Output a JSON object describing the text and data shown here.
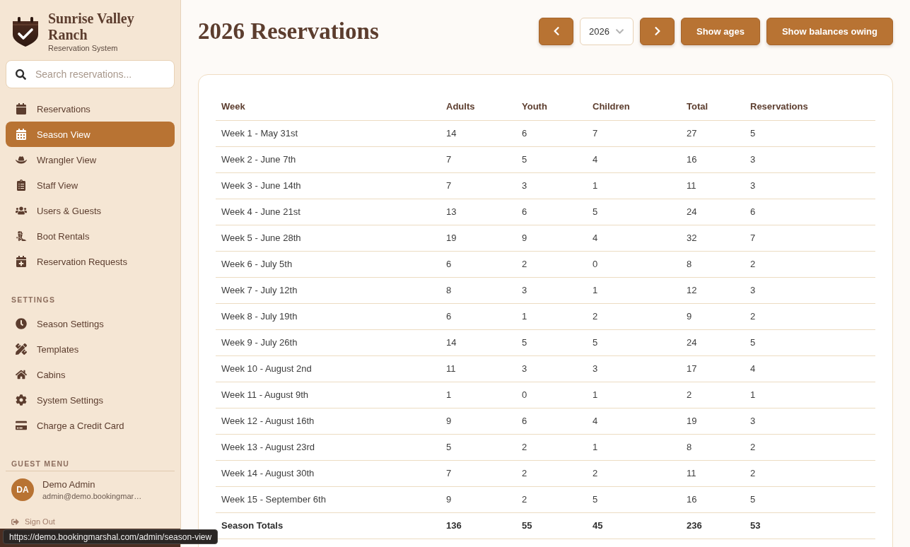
{
  "sidebar": {
    "brand": {
      "title": "Sunrise Valley Ranch",
      "subtitle": "Reservation System"
    },
    "search": {
      "placeholder": "Search reservations..."
    },
    "nav_items": [
      {
        "label": "Reservations",
        "selected": false
      },
      {
        "label": "Season View",
        "selected": true
      },
      {
        "label": "Wrangler View",
        "selected": false
      },
      {
        "label": "Staff View",
        "selected": false
      },
      {
        "label": "Users & Guests",
        "selected": false
      },
      {
        "label": "Boot Rentals",
        "selected": false
      },
      {
        "label": "Reservation Requests",
        "selected": false
      }
    ],
    "settings": {
      "heading": "SETTINGS",
      "items": [
        {
          "label": "Season Settings",
          "selected": false
        },
        {
          "label": "Templates",
          "selected": false
        },
        {
          "label": "Cabins",
          "selected": false
        },
        {
          "label": "System Settings",
          "selected": false
        },
        {
          "label": "Charge a Credit Card",
          "selected": false
        }
      ]
    },
    "guest_menu": {
      "heading": "GUEST MENU",
      "user": {
        "initials": "DA",
        "name": "Demo Admin",
        "email": "admin@demo.bookingmar…"
      },
      "sign_out": "Sign Out"
    }
  },
  "header": {
    "title": "2026 Reservations",
    "year_select": {
      "value": "2026"
    },
    "buttons": [
      "Show ages",
      "Show balances owing"
    ]
  },
  "table": {
    "columns": [
      "Week",
      "Adults",
      "Youth",
      "Children",
      "Total",
      "Reservations"
    ],
    "rows": [
      {
        "cells": [
          "Week 1 - May 31st",
          "14",
          "6",
          "7",
          "27",
          "5"
        ]
      },
      {
        "cells": [
          "Week 2 - June 7th",
          "7",
          "5",
          "4",
          "16",
          "3"
        ]
      },
      {
        "cells": [
          "Week 3 - June 14th",
          "7",
          "3",
          "1",
          "11",
          "3"
        ]
      },
      {
        "cells": [
          "Week 4 - June 21st",
          "13",
          "6",
          "5",
          "24",
          "6"
        ]
      },
      {
        "cells": [
          "Week 5 - June 28th",
          "19",
          "9",
          "4",
          "32",
          "7"
        ]
      },
      {
        "cells": [
          "Week 6 - July 5th",
          "6",
          "2",
          "0",
          "8",
          "2"
        ]
      },
      {
        "cells": [
          "Week 7 - July 12th",
          "8",
          "3",
          "1",
          "12",
          "3"
        ]
      },
      {
        "cells": [
          "Week 8 - July 19th",
          "6",
          "1",
          "2",
          "9",
          "2"
        ]
      },
      {
        "cells": [
          "Week 9 - July 26th",
          "14",
          "5",
          "5",
          "24",
          "5"
        ]
      },
      {
        "cells": [
          "Week 10 - August 2nd",
          "11",
          "3",
          "3",
          "17",
          "4"
        ]
      },
      {
        "cells": [
          "Week 11 - August 9th",
          "1",
          "0",
          "1",
          "2",
          "1"
        ]
      },
      {
        "cells": [
          "Week 12 - August 16th",
          "9",
          "6",
          "4",
          "19",
          "3"
        ]
      },
      {
        "cells": [
          "Week 13 - August 23rd",
          "5",
          "2",
          "1",
          "8",
          "2"
        ]
      },
      {
        "cells": [
          "Week 14 - August 30th",
          "7",
          "2",
          "2",
          "11",
          "2"
        ]
      },
      {
        "cells": [
          "Week 15 - September 6th",
          "9",
          "2",
          "5",
          "16",
          "5"
        ]
      }
    ],
    "totals": {
      "cells": [
        "Season Totals",
        "136",
        "55",
        "45",
        "236",
        "53"
      ]
    }
  },
  "status_tooltip": "https://demo.bookingmarshal.com/admin/season-view"
}
